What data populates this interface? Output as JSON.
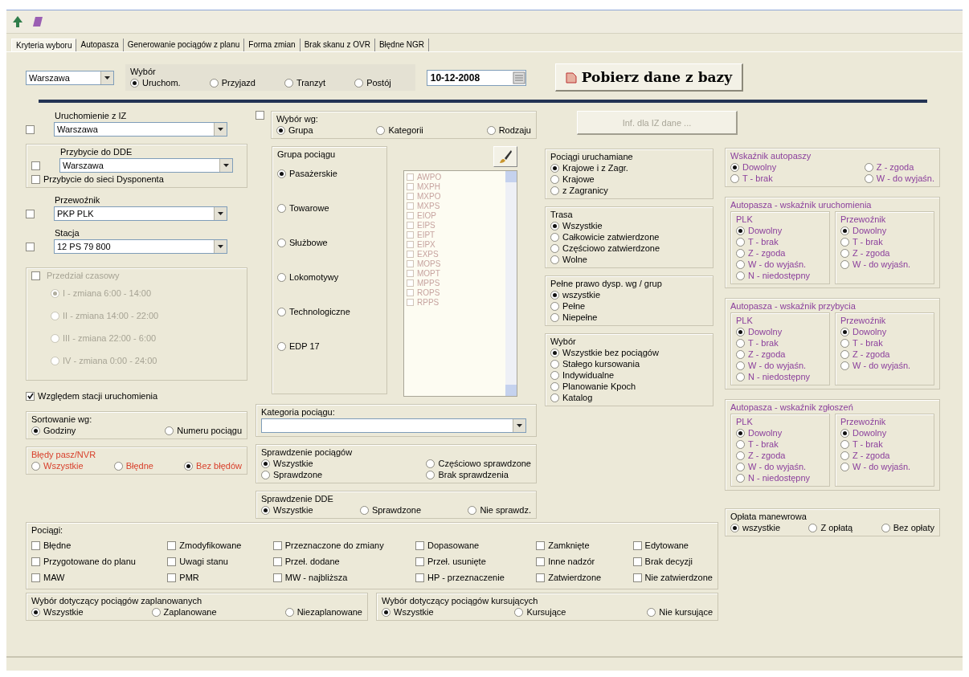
{
  "tabs": [
    {
      "label": "Kryteria wyboru",
      "selected": true
    },
    {
      "label": "Autopasza",
      "selected": false
    },
    {
      "label": "Generowanie pociągów z planu",
      "selected": false
    },
    {
      "label": "Forma zmian",
      "selected": false
    },
    {
      "label": "Brak skanu z OVR",
      "selected": false
    },
    {
      "label": "Błędne NGR",
      "selected": false
    }
  ],
  "top": {
    "region": {
      "value": "Warszawa"
    },
    "mode": {
      "title": "Wybór",
      "options": [
        {
          "label": "Uruchom.",
          "selected": true
        },
        {
          "label": "Przyjazd",
          "selected": false
        },
        {
          "label": "Tranzyt",
          "selected": false
        },
        {
          "label": "Postój",
          "selected": false
        }
      ]
    },
    "date": {
      "value": "10-12-2008"
    },
    "fetch_button": {
      "label": "Pobierz dane z bazy"
    }
  },
  "column_1": {
    "iz": {
      "checked": false,
      "title": "Uruchomienie z IZ",
      "value": "Warszawa"
    },
    "dde": {
      "checked": false,
      "title": "Przybycie do DDE",
      "value": "Warszawa",
      "extra": {
        "label": "Przybycie do sieci Dysponenta",
        "checked": false
      }
    },
    "carrier": {
      "checked": false,
      "title": "Przewoźnik",
      "value": "PKP PLK"
    },
    "station": {
      "checked": false,
      "title": "Stacja",
      "value": "12 PS 79 800"
    },
    "time_range": {
      "checked": false,
      "title": "Przedział czasowy",
      "disabled": true,
      "options": [
        {
          "label": "I - zmiana  6:00 - 14:00",
          "selected": true
        },
        {
          "label": "II - zmiana  14:00 - 22:00",
          "selected": false
        },
        {
          "label": "III - zmiana  22:00 - 6:00",
          "selected": false
        },
        {
          "label": "IV - zmiana  0:00 - 24:00",
          "selected": false
        }
      ]
    },
    "relative": {
      "label": "Względem stacji uruchomienia",
      "checked": true
    },
    "sort": {
      "title": "Sortowanie wg:",
      "options": [
        {
          "label": "Godziny",
          "selected": true
        },
        {
          "label": "Numeru pociągu",
          "selected": false
        }
      ]
    },
    "errors": {
      "title": "Błędy pasz/NVR",
      "options": [
        {
          "label": "Wszystkie",
          "selected": false
        },
        {
          "label": "Błędne",
          "selected": false
        },
        {
          "label": "Bez błędów",
          "selected": true
        }
      ]
    }
  },
  "column_2": {
    "select_by": {
      "checked": false,
      "title": "Wybór wg:",
      "options": [
        {
          "label": "Grupa",
          "selected": true
        },
        {
          "label": "Kategorii",
          "selected": false
        },
        {
          "label": "Rodzaju",
          "selected": false
        }
      ]
    },
    "train_group": {
      "title": "Grupa pociągu",
      "options": [
        {
          "label": "Pasażerskie",
          "selected": true
        },
        {
          "label": "Towarowe",
          "selected": false
        },
        {
          "label": "Służbowe",
          "selected": false
        },
        {
          "label": "Lokomotywy",
          "selected": false
        },
        {
          "label": "Technologiczne",
          "selected": false
        },
        {
          "label": "EDP 17",
          "selected": false
        }
      ]
    },
    "codes": [
      {
        "label": "AWPO",
        "checked": false
      },
      {
        "label": "MXPH",
        "checked": false
      },
      {
        "label": "MXPO",
        "checked": false
      },
      {
        "label": "MXPS",
        "checked": false
      },
      {
        "label": "EIOP",
        "checked": false
      },
      {
        "label": "EIPS",
        "checked": false
      },
      {
        "label": "EIPT",
        "checked": false
      },
      {
        "label": "EIPX",
        "checked": false
      },
      {
        "label": "EXPS",
        "checked": false
      },
      {
        "label": "MOPS",
        "checked": false
      },
      {
        "label": "MOPT",
        "checked": false
      },
      {
        "label": "MPPS",
        "checked": false
      },
      {
        "label": "ROPS",
        "checked": false
      },
      {
        "label": "RPPS",
        "checked": false
      }
    ],
    "category": {
      "title": "Kategoria pociągu:"
    },
    "check_trains": {
      "title": "Sprawdzenie pociągów",
      "options": [
        {
          "label": "Wszystkie",
          "selected": true
        },
        {
          "label": "Częściowo sprawdzone",
          "selected": false
        },
        {
          "label": "Sprawdzone",
          "selected": false
        },
        {
          "label": "Brak sprawdzenia",
          "selected": false
        }
      ]
    },
    "check_dde": {
      "title": "Sprawdzenie DDE",
      "options": [
        {
          "label": "Wszystkie",
          "selected": true
        },
        {
          "label": "Sprawdzone",
          "selected": false
        },
        {
          "label": "Nie sprawdz.",
          "selected": false
        }
      ]
    }
  },
  "column_3": {
    "info_button": {
      "label": "Inf. dla IZ dane ...",
      "disabled": true
    },
    "groups": [
      {
        "title": "Pociągi uruchamiane",
        "options": [
          {
            "label": "Krajowe i z Zagr.",
            "selected": true
          },
          {
            "label": "Krajowe",
            "selected": false
          },
          {
            "label": "z Zagranicy",
            "selected": false
          }
        ]
      },
      {
        "title": "Trasa",
        "options": [
          {
            "label": "Wszystkie",
            "selected": true
          },
          {
            "label": "Całkowicie zatwierdzone",
            "selected": false
          },
          {
            "label": "Częściowo zatwierdzone",
            "selected": false
          },
          {
            "label": "Wolne",
            "selected": false
          }
        ]
      },
      {
        "title": "Pełne prawo dysp. wg / grup",
        "options": [
          {
            "label": "wszystkie",
            "selected": true
          },
          {
            "label": "Pełne",
            "selected": false
          },
          {
            "label": "Niepełne",
            "selected": false
          }
        ]
      },
      {
        "title": "Wybór",
        "options": [
          {
            "label": "Wszystkie bez pociągów",
            "selected": true
          },
          {
            "label": "Stałego kursowania",
            "selected": false
          },
          {
            "label": "Indywidualne",
            "selected": false
          },
          {
            "label": "Planowanie Kpoch",
            "selected": false
          },
          {
            "label": "Katalog",
            "selected": false
          }
        ]
      }
    ]
  },
  "column_4": {
    "autopasza": {
      "title": "Wskaźnik autopaszy",
      "options": [
        {
          "label": "Dowolny",
          "selected": true
        },
        {
          "label": "Z - zgoda",
          "selected": false
        },
        {
          "label": "T - brak",
          "selected": false
        },
        {
          "label": "W - do wyjaśn.",
          "selected": false
        }
      ]
    },
    "indicators": [
      {
        "title": "Autopasza - wskaźnik uruchomienia",
        "parts": [
          {
            "title": "PLK",
            "options": [
              {
                "label": "Dowolny",
                "selected": true
              },
              {
                "label": "T - brak",
                "selected": false
              },
              {
                "label": "Z - zgoda",
                "selected": false
              },
              {
                "label": "W - do wyjaśn.",
                "selected": false
              },
              {
                "label": "N - niedostępny",
                "selected": false
              }
            ]
          },
          {
            "title": "Przewoźnik",
            "options": [
              {
                "label": "Dowolny",
                "selected": true
              },
              {
                "label": "T - brak",
                "selected": false
              },
              {
                "label": "Z - zgoda",
                "selected": false
              },
              {
                "label": "W - do wyjaśn.",
                "selected": false
              }
            ]
          }
        ]
      },
      {
        "title": "Autopasza - wskaźnik przybycia",
        "parts": [
          {
            "title": "PLK",
            "options": [
              {
                "label": "Dowolny",
                "selected": true
              },
              {
                "label": "T - brak",
                "selected": false
              },
              {
                "label": "Z - zgoda",
                "selected": false
              },
              {
                "label": "W - do wyjaśn.",
                "selected": false
              },
              {
                "label": "N - niedostępny",
                "selected": false
              }
            ]
          },
          {
            "title": "Przewoźnik",
            "options": [
              {
                "label": "Dowolny",
                "selected": true
              },
              {
                "label": "T - brak",
                "selected": false
              },
              {
                "label": "Z - zgoda",
                "selected": false
              },
              {
                "label": "W - do wyjaśn.",
                "selected": false
              }
            ]
          }
        ]
      },
      {
        "title": "Autopasza - wskaźnik zgłoszeń",
        "parts": [
          {
            "title": "PLK",
            "options": [
              {
                "label": "Dowolny",
                "selected": true
              },
              {
                "label": "T - brak",
                "selected": false
              },
              {
                "label": "Z - zgoda",
                "selected": false
              },
              {
                "label": "W - do wyjaśn.",
                "selected": false
              },
              {
                "label": "N - niedostępny",
                "selected": false
              }
            ]
          },
          {
            "title": "Przewoźnik",
            "options": [
              {
                "label": "Dowolny",
                "selected": true
              },
              {
                "label": "T - brak",
                "selected": false
              },
              {
                "label": "Z - zgoda",
                "selected": false
              },
              {
                "label": "W - do wyjaśn.",
                "selected": false
              }
            ]
          }
        ]
      }
    ],
    "fee": {
      "title": "Opłata manewrowa",
      "options": [
        {
          "label": "wszystkie",
          "selected": true
        },
        {
          "label": "Z opłatą",
          "selected": false
        },
        {
          "label": "Bez opłaty",
          "selected": false
        }
      ]
    }
  },
  "trains": {
    "title": "Pociągi:",
    "items": [
      {
        "label": "Błędne",
        "checked": false
      },
      {
        "label": "Zmodyfikowane",
        "checked": false
      },
      {
        "label": "Przeznaczone do zmiany",
        "checked": false
      },
      {
        "label": "Dopasowane",
        "checked": false
      },
      {
        "label": "Zamknięte",
        "checked": false
      },
      {
        "label": "Edytowane",
        "checked": false
      },
      {
        "label": "Przygotowane do planu",
        "checked": false
      },
      {
        "label": "Uwagi stanu",
        "checked": false
      },
      {
        "label": "Przeł. dodane",
        "checked": false
      },
      {
        "label": "Przeł. usunięte",
        "checked": false
      },
      {
        "label": "Inne nadzór",
        "checked": false
      },
      {
        "label": "Brak decyzji",
        "checked": false
      },
      {
        "label": "MAW",
        "checked": false
      },
      {
        "label": "PMR",
        "checked": false
      },
      {
        "label": "MW - najbliższa",
        "checked": false
      },
      {
        "label": "HP - przeznaczenie",
        "checked": false
      },
      {
        "label": "Zatwierdzone",
        "checked": false
      },
      {
        "label": "Nie zatwierdzone",
        "checked": false
      }
    ]
  },
  "planned": {
    "title": "Wybór dotyczący pociągów zaplanowanych",
    "options": [
      {
        "label": "Wszystkie",
        "selected": true
      },
      {
        "label": "Zaplanowane",
        "selected": false
      },
      {
        "label": "Niezaplanowane",
        "selected": false
      }
    ]
  },
  "running": {
    "title": "Wybór dotyczący pociągów kursujących",
    "options": [
      {
        "label": "Wszystkie",
        "selected": true
      },
      {
        "label": "Kursujące",
        "selected": false
      },
      {
        "label": "Nie kursujące",
        "selected": false
      }
    ]
  }
}
